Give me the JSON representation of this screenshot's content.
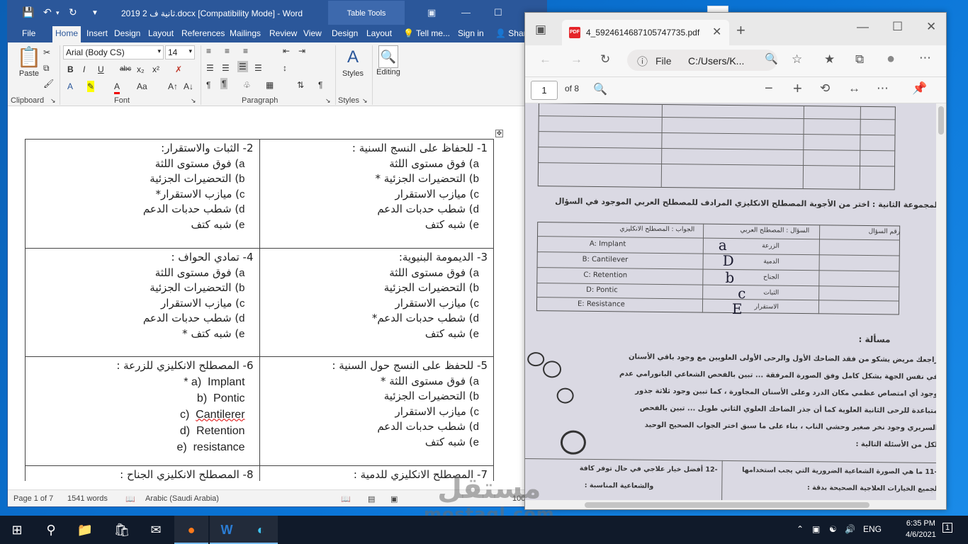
{
  "word": {
    "title": "ثانية ف 2 2019.docx [Compatibility Mode] - Word",
    "table_tools": "Table Tools",
    "tabs": [
      "File",
      "Home",
      "Insert",
      "Design",
      "Layout",
      "References",
      "Mailings",
      "Review",
      "View",
      "Design",
      "Layout"
    ],
    "tell_me": "Tell me...",
    "sign_in": "Sign in",
    "share": "Share",
    "ribbon": {
      "paste": "Paste",
      "clipboard": "Clipboard",
      "font_name": "Arial (Body CS)",
      "font_size": "14",
      "font": "Font",
      "paragraph": "Paragraph",
      "styles_btn": "Styles",
      "styles": "Styles",
      "editing": "Editing"
    },
    "status": {
      "page": "Page 1 of 7",
      "words": "1541 words",
      "language": "Arabic (Saudi Arabia)",
      "zoom": "100"
    },
    "questions": [
      {
        "title": "1- للحفاظ على النسج السنية :",
        "options": [
          "فوق مستوى اللثة",
          "التحضيرات الجزئية *",
          "ميازب الاستقرار",
          "شطب حدبات الدعم",
          "شبه كتف"
        ]
      },
      {
        "title": "2- الثبات والاستقرار:",
        "options": [
          "فوق مستوى اللثة",
          "التحضيرات الجزئية",
          "ميازب الاستقرار*",
          "شطب حدبات الدعم",
          "شبه كتف"
        ]
      },
      {
        "title": "3- الديمومة البنيوية:",
        "options": [
          "فوق مستوى اللثة",
          "التحضيرات الجزئية",
          "ميازب الاستقرار",
          "شطب حدبات الدعم*",
          "شبه كتف"
        ]
      },
      {
        "title": "4- تمادي الحواف :",
        "options": [
          "فوق مستوى اللثة",
          "التحضيرات الجزئية",
          "ميازب الاستقرار",
          "شطب حدبات الدعم",
          "شبه كتف *"
        ]
      },
      {
        "title": "5- للحفظ على النسج حول السنية :",
        "options": [
          "فوق مستوى اللثة *",
          "التحضيرات الجزئية",
          "ميازب الاستقرار",
          "شطب حدبات الدعم",
          "شبه كتف"
        ]
      },
      {
        "title": "6- المصطلح الانكليزي للزرعة :",
        "options": [
          "Implant *",
          "Pontic",
          "Cantilerer",
          "Retention",
          "resistance"
        ]
      },
      {
        "title": "7- المصطلح الانكليزي للدمية :",
        "options": []
      },
      {
        "title": "8- المصطلح الانكليزي الجناح :",
        "options": []
      }
    ],
    "letters": [
      "a",
      "b",
      "c",
      "d",
      "e"
    ]
  },
  "pdf": {
    "tab_title": "4_5924614687105747735.pdf",
    "file_label": "File",
    "url": "C:/Users/K...",
    "page_number": "1",
    "page_total": "of 8",
    "scan": {
      "heading2": "المجموعة الثانية : اختر من الأجوبة المصطلح الانكليزي المرادف للمصطلح العربي الموجود في السؤال",
      "col_headers": [
        "رقم السؤال",
        "السؤال : المصطلح العربي",
        "الجواب : المصطلح الانكليزي"
      ],
      "terms": [
        "A: Implant",
        "B: Cantilever",
        "C: Retention",
        "D: Pontic",
        "E: Resistance"
      ],
      "arabic_terms": [
        "الزرعة",
        "الدمية",
        "الجناح",
        "الثبات",
        "الاستقرار"
      ],
      "handwritten": [
        "a",
        "D",
        "b",
        "c",
        "E"
      ],
      "case_title": "مسألة :",
      "case_lines": [
        "راجعك مريض يشكو من فقد الضاحك الأول والرحى الأولى العلويين مع وجود باقي الأسنان",
        "في نفس الجهة بشكل كامل وفق الصورة المرفقة ... تبين بالفحص الشعاعي البانورامي عدم",
        "وجود أي امتصاص عظمي مكان الدرد وعلى الأسنان المجاورة ، كما تبين وجود ثلاثة جذور",
        "متباعدة للرحى الثانية العلوية كما أن جذر الضاحك العلوي الثاني طويل ... تبين بالفحص",
        "السريري وجود نخر صغير وحشي الناب ، بناء على ما سبق اختر الجواب الصحيح الوحيد",
        "لكل من الأسئلة التالية :"
      ],
      "bottom_q1": "-11 ما هي الصورة الشعاعية الضرورية التي يجب استخدامها",
      "bottom_q2": "-12 أفضل خيار علاجي في حال توفر كافة",
      "bottom_q3": "والشعاعية المناسبة :",
      "bottom_q4": "لجميع الخيارات العلاجية الصحيحة بدقة :"
    }
  },
  "taskbar": {
    "language": "ENG",
    "time": "6:35 PM",
    "date": "4/6/2021",
    "notifications": "1"
  },
  "watermark": {
    "arabic": "مستقل",
    "latin": "mostaql.com"
  }
}
